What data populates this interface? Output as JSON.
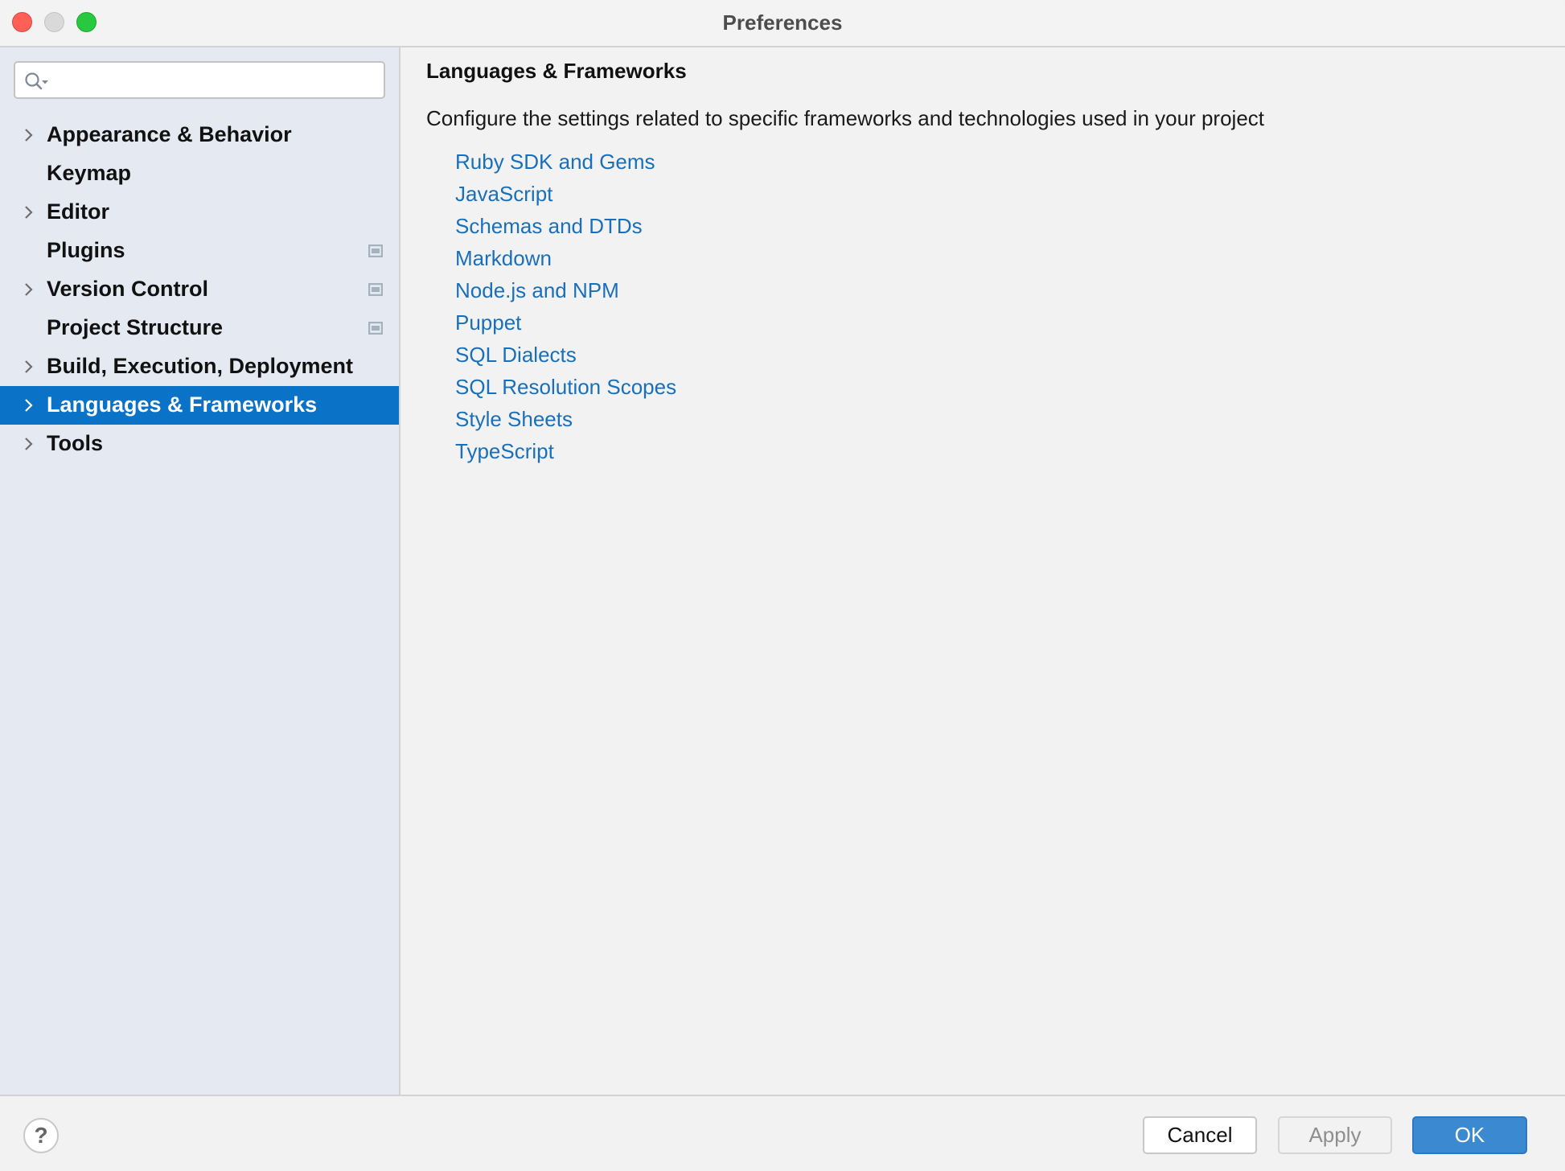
{
  "window": {
    "title": "Preferences",
    "controls": [
      "close",
      "minimize",
      "maximize"
    ]
  },
  "sidebar": {
    "search": {
      "value": "",
      "placeholder": ""
    },
    "items": [
      {
        "label": "Appearance & Behavior",
        "expandable": true,
        "selected": false,
        "project_icon": false
      },
      {
        "label": "Keymap",
        "expandable": false,
        "selected": false,
        "project_icon": false
      },
      {
        "label": "Editor",
        "expandable": true,
        "selected": false,
        "project_icon": false
      },
      {
        "label": "Plugins",
        "expandable": false,
        "selected": false,
        "project_icon": true
      },
      {
        "label": "Version Control",
        "expandable": true,
        "selected": false,
        "project_icon": true
      },
      {
        "label": "Project Structure",
        "expandable": false,
        "selected": false,
        "project_icon": true
      },
      {
        "label": "Build, Execution, Deployment",
        "expandable": true,
        "selected": false,
        "project_icon": false
      },
      {
        "label": "Languages & Frameworks",
        "expandable": true,
        "selected": true,
        "project_icon": false
      },
      {
        "label": "Tools",
        "expandable": true,
        "selected": false,
        "project_icon": false
      }
    ]
  },
  "content": {
    "heading": "Languages & Frameworks",
    "description": "Configure the settings related to specific frameworks and technologies used in your project",
    "links": [
      "Ruby SDK and Gems",
      "JavaScript",
      "Schemas and DTDs",
      "Markdown",
      "Node.js and NPM",
      "Puppet",
      "SQL Dialects",
      "SQL Resolution Scopes",
      "Style Sheets",
      "TypeScript"
    ]
  },
  "footer": {
    "help_label": "?",
    "cancel_label": "Cancel",
    "apply_label": "Apply",
    "ok_label": "OK",
    "apply_enabled": false
  },
  "colors": {
    "selection": "#0a72c7",
    "link": "#1a6fb8",
    "ok_button": "#3b89d0",
    "sidebar_bg": "#e5e9f1"
  }
}
